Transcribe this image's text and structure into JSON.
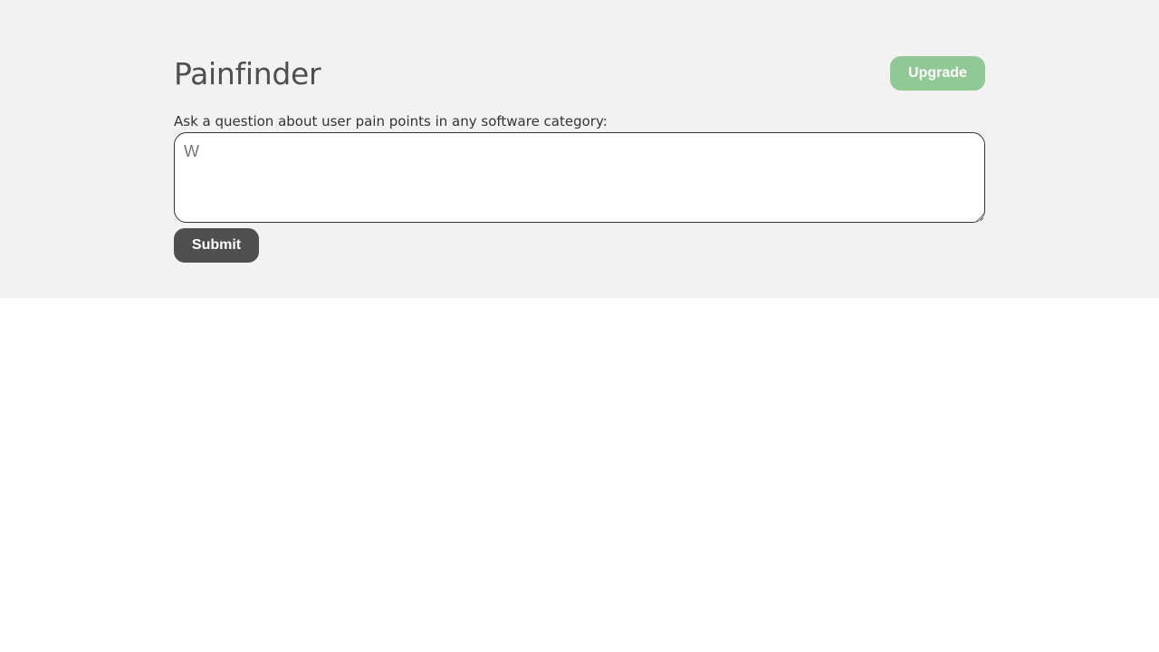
{
  "app": {
    "title": "Painfinder"
  },
  "header": {
    "upgrade_label": "Upgrade"
  },
  "form": {
    "question_label": "Ask a question about user pain points in any software category:",
    "question_placeholder": "W",
    "question_value": "",
    "submit_label": "Submit"
  },
  "colors": {
    "band_background": "#f2f2f2",
    "upgrade_button": "#90c995",
    "submit_button": "#4f4f4f",
    "title_text": "#4f4f4f"
  }
}
